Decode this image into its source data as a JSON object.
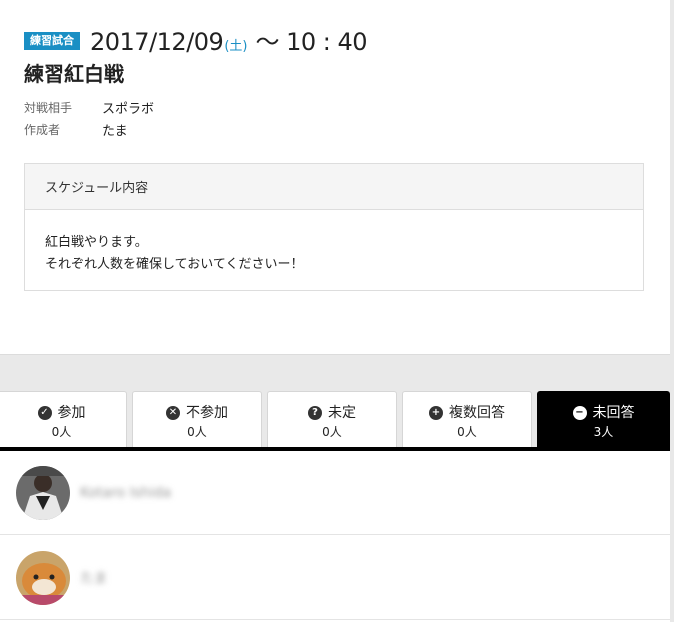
{
  "event": {
    "badge": "練習試合",
    "date": "2017/12/09",
    "weekday": "(土)",
    "time": "〜 10 : 40",
    "title": "練習紅白戦"
  },
  "meta": [
    {
      "label": "対戦相手",
      "value": "スポラボ"
    },
    {
      "label": "作成者",
      "value": "たま"
    }
  ],
  "schedule": {
    "heading": "スケジュール内容",
    "lines": [
      "紅白戦やります。",
      "それぞれ人数を確保しておいてくださいー！"
    ]
  },
  "tabs": [
    {
      "label": "参加",
      "count": "0人",
      "icon": "check-circle-icon",
      "glyph": "✓",
      "active": false
    },
    {
      "label": "不参加",
      "count": "0人",
      "icon": "times-circle-icon",
      "glyph": "✕",
      "active": false
    },
    {
      "label": "未定",
      "count": "0人",
      "icon": "question-circle-icon",
      "glyph": "?",
      "active": false
    },
    {
      "label": "複数回答",
      "count": "0人",
      "icon": "plus-circle-icon",
      "glyph": "+",
      "active": false
    },
    {
      "label": "未回答",
      "count": "3人",
      "icon": "minus-circle-icon",
      "glyph": "−",
      "active": true
    }
  ],
  "members": [
    {
      "name": "Kotaro Ishida"
    },
    {
      "name": "たま"
    }
  ],
  "colors": {
    "accent": "#1a8fc4",
    "active_tab": "#000000",
    "band": "#e9e9e9"
  }
}
